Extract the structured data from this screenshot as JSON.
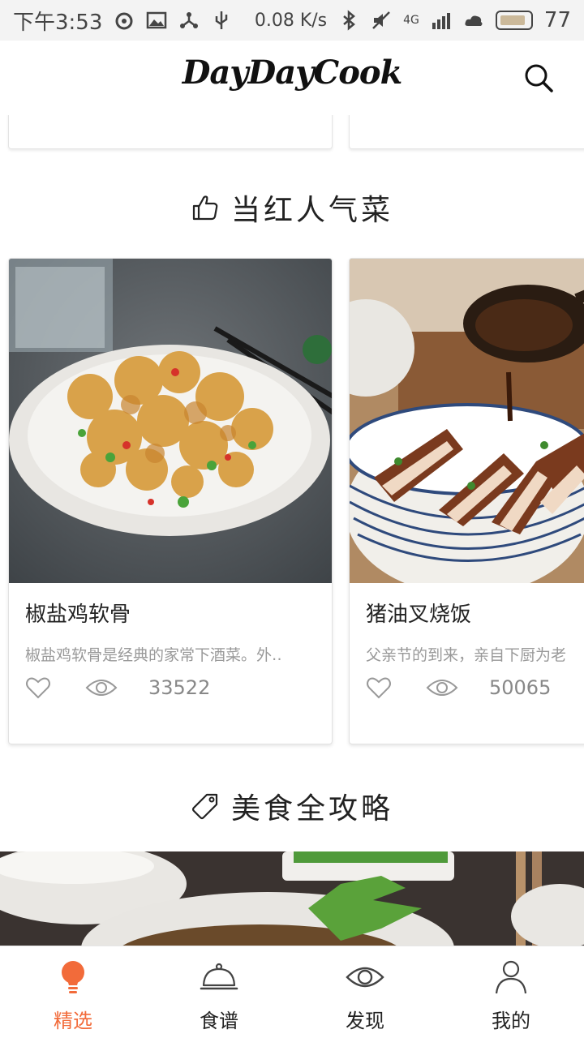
{
  "status_bar": {
    "time": "下午3:53",
    "network_speed": "0.08 K/s",
    "signal": "4G",
    "battery": "77"
  },
  "app": {
    "logo": "DayDayCook"
  },
  "sections": {
    "popular": {
      "title": "当红人气菜"
    },
    "guide": {
      "title": "美食全攻略"
    }
  },
  "recipes": [
    {
      "title": "椒盐鸡软骨",
      "description": "椒盐鸡软骨是经典的家常下酒菜。外‥",
      "views": "33522"
    },
    {
      "title": "猪油叉烧饭",
      "description": "父亲节的到来，亲自下厨为老",
      "views": "50065"
    }
  ],
  "tabs": [
    {
      "label": "精选",
      "icon": "lightbulb-icon",
      "active": true
    },
    {
      "label": "食谱",
      "icon": "cloche-icon",
      "active": false
    },
    {
      "label": "发现",
      "icon": "eye-icon",
      "active": false
    },
    {
      "label": "我的",
      "icon": "person-icon",
      "active": false
    }
  ],
  "colors": {
    "accent": "#f26b3a",
    "text": "#222222",
    "muted": "#999999"
  }
}
